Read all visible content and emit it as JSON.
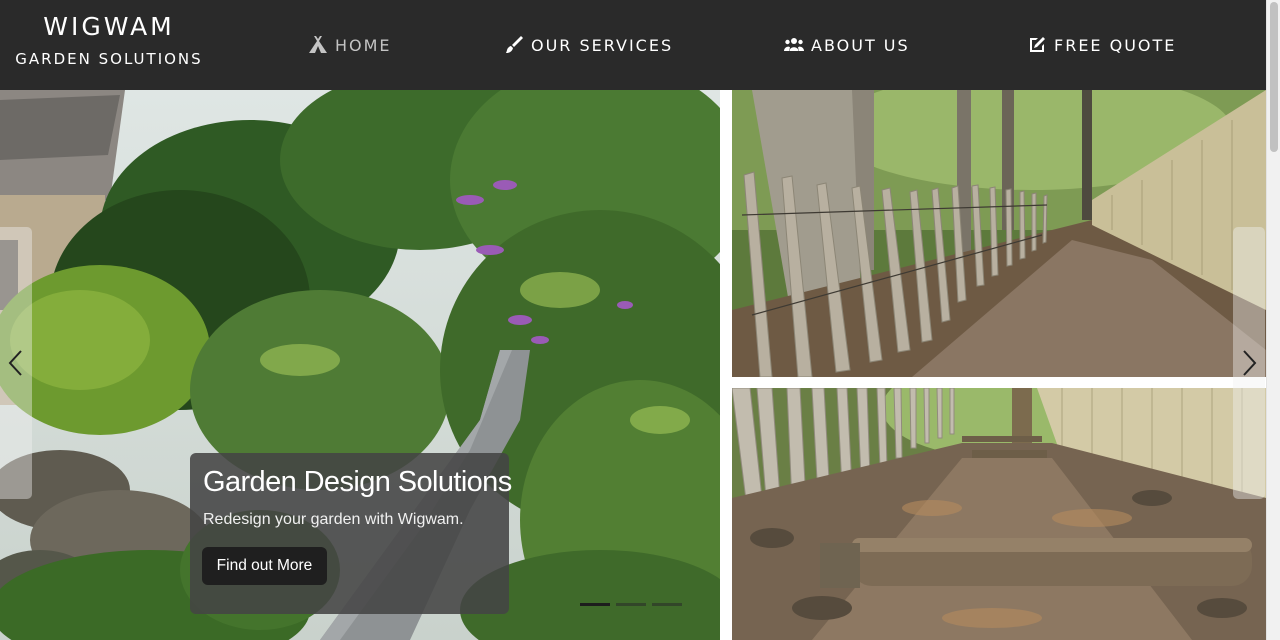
{
  "brand": {
    "title": "WIGWAM",
    "subtitle": "GARDEN SOLUTIONS"
  },
  "nav": {
    "items": [
      {
        "label": "HOME",
        "icon": "tent-icon",
        "active": true
      },
      {
        "label": "OUR SERVICES",
        "icon": "paint-brush-icon",
        "active": false
      },
      {
        "label": "ABOUT US",
        "icon": "users-icon",
        "active": false
      },
      {
        "label": "FREE QUOTE",
        "icon": "edit-icon",
        "active": false
      }
    ]
  },
  "carousel": {
    "caption": {
      "title": "Garden Design Solutions",
      "text": "Redesign your garden with Wigwam.",
      "button": "Find out More"
    },
    "prev_icon": "chevron-left-icon",
    "next_icon": "chevron-right-icon",
    "slide_count": 3,
    "active_slide": 1
  },
  "photos": [
    {
      "subject": "garden-path-photo"
    },
    {
      "subject": "woodland-fence-photo"
    },
    {
      "subject": "chestnut-fence-path-photo"
    }
  ],
  "colors": {
    "header_bg": "#2a2a2a",
    "nav_text": "#ffffff",
    "nav_active_text": "#c4c4c4",
    "caption_bg": "#444444",
    "button_bg": "#1f1f1f"
  }
}
